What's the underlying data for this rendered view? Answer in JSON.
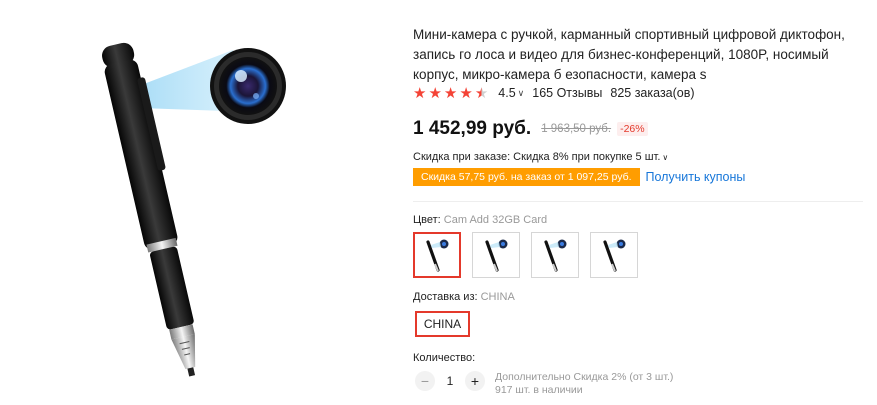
{
  "product": {
    "title": "Мини-камера с ручкой, карманный спортивный цифровой диктофон, запись го лоса и видео для бизнес-конференций, 1080P, носимый корпус, микро-камера б езопасности, камера s",
    "rating": {
      "stars": 4.5,
      "value": "4.5",
      "reviews": "165 Отзывы",
      "orders": "825 заказа(ов)"
    },
    "price": {
      "current": "1 452,99 руб.",
      "old": "1 963,50 руб.",
      "discount": "-26%"
    },
    "order_discount": "Скидка при заказе: Скидка 8% при покупке 5 шт.",
    "coupon": {
      "badge": "Скидка 57,75 руб. на заказ от 1 097,25 руб.",
      "link": "Получить купоны"
    },
    "color": {
      "label": "Цвет:",
      "value": "Cam Add 32GB Card",
      "swatch_count": 4,
      "selected_index": 0
    },
    "shipping": {
      "label": "Доставка из:",
      "value": "CHINA",
      "option": "CHINA"
    },
    "quantity": {
      "label": "Количество:",
      "minus": "−",
      "value": "1",
      "plus": "+",
      "extra_discount": "Дополнительно Скидка 2% (от 3 шт.)",
      "stock": "917 шт. в наличии"
    }
  },
  "colors": {
    "accent": "#e4392b",
    "star": "#f44336",
    "coupon_bg": "#ff9d00",
    "link": "#1676d9"
  }
}
